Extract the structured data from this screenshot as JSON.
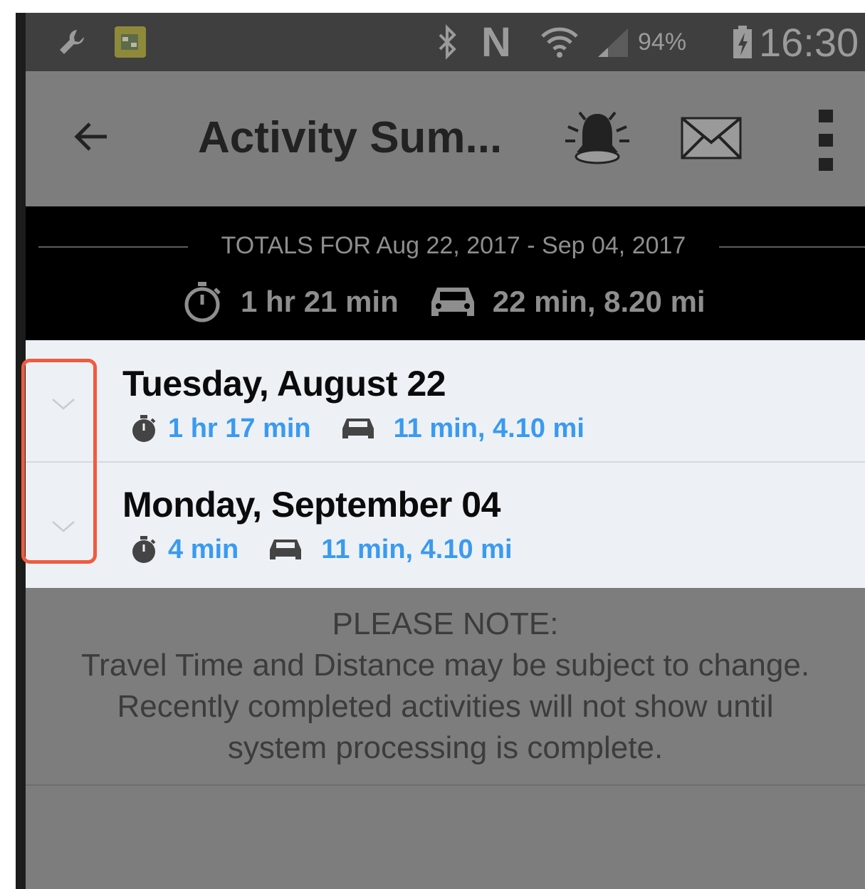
{
  "status_bar": {
    "battery": "94%",
    "time": "16:30",
    "icons": [
      "wrench-icon",
      "app-notification-icon",
      "bluetooth-icon",
      "nfc-icon",
      "wifi-icon",
      "signal-icon",
      "battery-charging-icon"
    ]
  },
  "app_bar": {
    "title": "Activity Sum...",
    "icons": [
      "back-arrow-icon",
      "alarm-bell-icon",
      "mail-icon",
      "more-vert-icon"
    ]
  },
  "totals": {
    "label": "TOTALS FOR Aug 22, 2017 - Sep 04, 2017",
    "time": "1 hr 21 min",
    "travel": "22 min, 8.20 mi"
  },
  "days": [
    {
      "title": "Tuesday, August 22",
      "time": "1 hr 17 min",
      "travel": "11 min, 4.10 mi"
    },
    {
      "title": "Monday, September 04",
      "time": "4 min",
      "travel": "11 min, 4.10 mi"
    }
  ],
  "note": {
    "heading": "PLEASE NOTE:",
    "line1": "Travel Time and Distance may be subject to change.",
    "line2": "Recently completed activities will not show until",
    "line3": "system processing is complete."
  },
  "colors": {
    "accent_blue": "#3a9af0",
    "highlight": "#f05b3f",
    "overlay_gray": "#7d7d7d"
  }
}
